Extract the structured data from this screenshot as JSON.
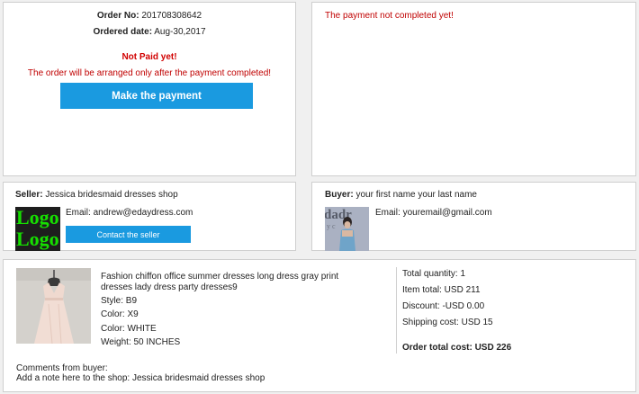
{
  "order": {
    "order_no_label": "Order No:",
    "order_no_value": "201708308642",
    "date_label": "Ordered date:",
    "date_value": "Aug-30,2017",
    "status": "Not Paid yet!",
    "note": "The order will be arranged only after the payment completed!",
    "pay_button": "Make the payment"
  },
  "payment_status": {
    "text": "The payment not completed yet!"
  },
  "seller": {
    "label": "Seller:",
    "name": "Jessica bridesmaid dresses shop",
    "logo_text_1": "Logo",
    "logo_text_2": "Logo",
    "email_label": "Email:",
    "email": "andrew@edaydress.com",
    "contact_button": "Contact the seller"
  },
  "buyer": {
    "label": "Buyer:",
    "name": "your first name your last name",
    "email_label": "Email:",
    "email": "youremail@gmail.com"
  },
  "item": {
    "title": "Fashion chiffon office summer dresses long dress gray print dresses lady dress party dresses9",
    "style": "Style: B9",
    "color1": "Color: X9",
    "color2": "Color: WHITE",
    "weight": "Weight: 50 INCHES"
  },
  "totals": {
    "quantity": "Total quantity: 1",
    "item_total": "Item total: USD 211",
    "discount": "Discount: -USD 0.00",
    "shipping": "Shipping cost: USD 15",
    "order_total": "Order total cost: USD 226"
  },
  "comments": {
    "label": "Comments from buyer:",
    "text": "Add a note here to the shop: Jessica bridesmaid dresses shop"
  },
  "colors": {
    "accent_button": "#1a9ae0",
    "alert_red": "#c00000",
    "logo_green": "#16e000"
  }
}
